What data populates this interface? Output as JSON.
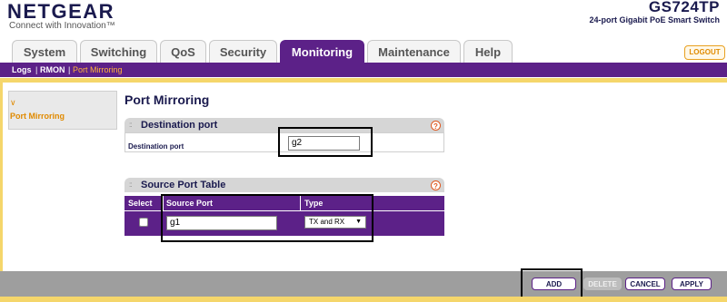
{
  "brand": {
    "logo": "NETGEAR",
    "tagline": "Connect with Innovation™"
  },
  "device": {
    "model": "GS724TP",
    "description": "24-port Gigabit PoE Smart Switch"
  },
  "tabs": [
    {
      "label": "System"
    },
    {
      "label": "Switching"
    },
    {
      "label": "QoS"
    },
    {
      "label": "Security"
    },
    {
      "label": "Monitoring",
      "active": true
    },
    {
      "label": "Maintenance"
    },
    {
      "label": "Help"
    }
  ],
  "logout_label": "LOGOUT",
  "subnav": [
    {
      "label": "Logs"
    },
    {
      "label": "RMON"
    },
    {
      "label": "Port Mirroring",
      "current": true
    }
  ],
  "subnav_separator": "|",
  "left_menu": {
    "arrow": "∨",
    "item": "Port Mirroring"
  },
  "page_title": "Port Mirroring",
  "destination": {
    "panel_title": "Destination port",
    "help": "?",
    "field_label": "Destination port",
    "value": "g2"
  },
  "source_table": {
    "panel_title": "Source Port Table",
    "help": "?",
    "columns": {
      "select": "Select",
      "source_port": "Source Port",
      "type": "Type"
    },
    "row": {
      "source_port": "g1",
      "type": "TX and RX",
      "type_arrow": "▼"
    }
  },
  "buttons": {
    "add": "ADD",
    "delete": "DELETE",
    "cancel": "CANCEL",
    "apply": "APPLY"
  },
  "colors": {
    "accent": "#5c2188",
    "highlight": "#ffb33a",
    "stripe": "#f5d66b",
    "footer": "#9e9e9e"
  }
}
